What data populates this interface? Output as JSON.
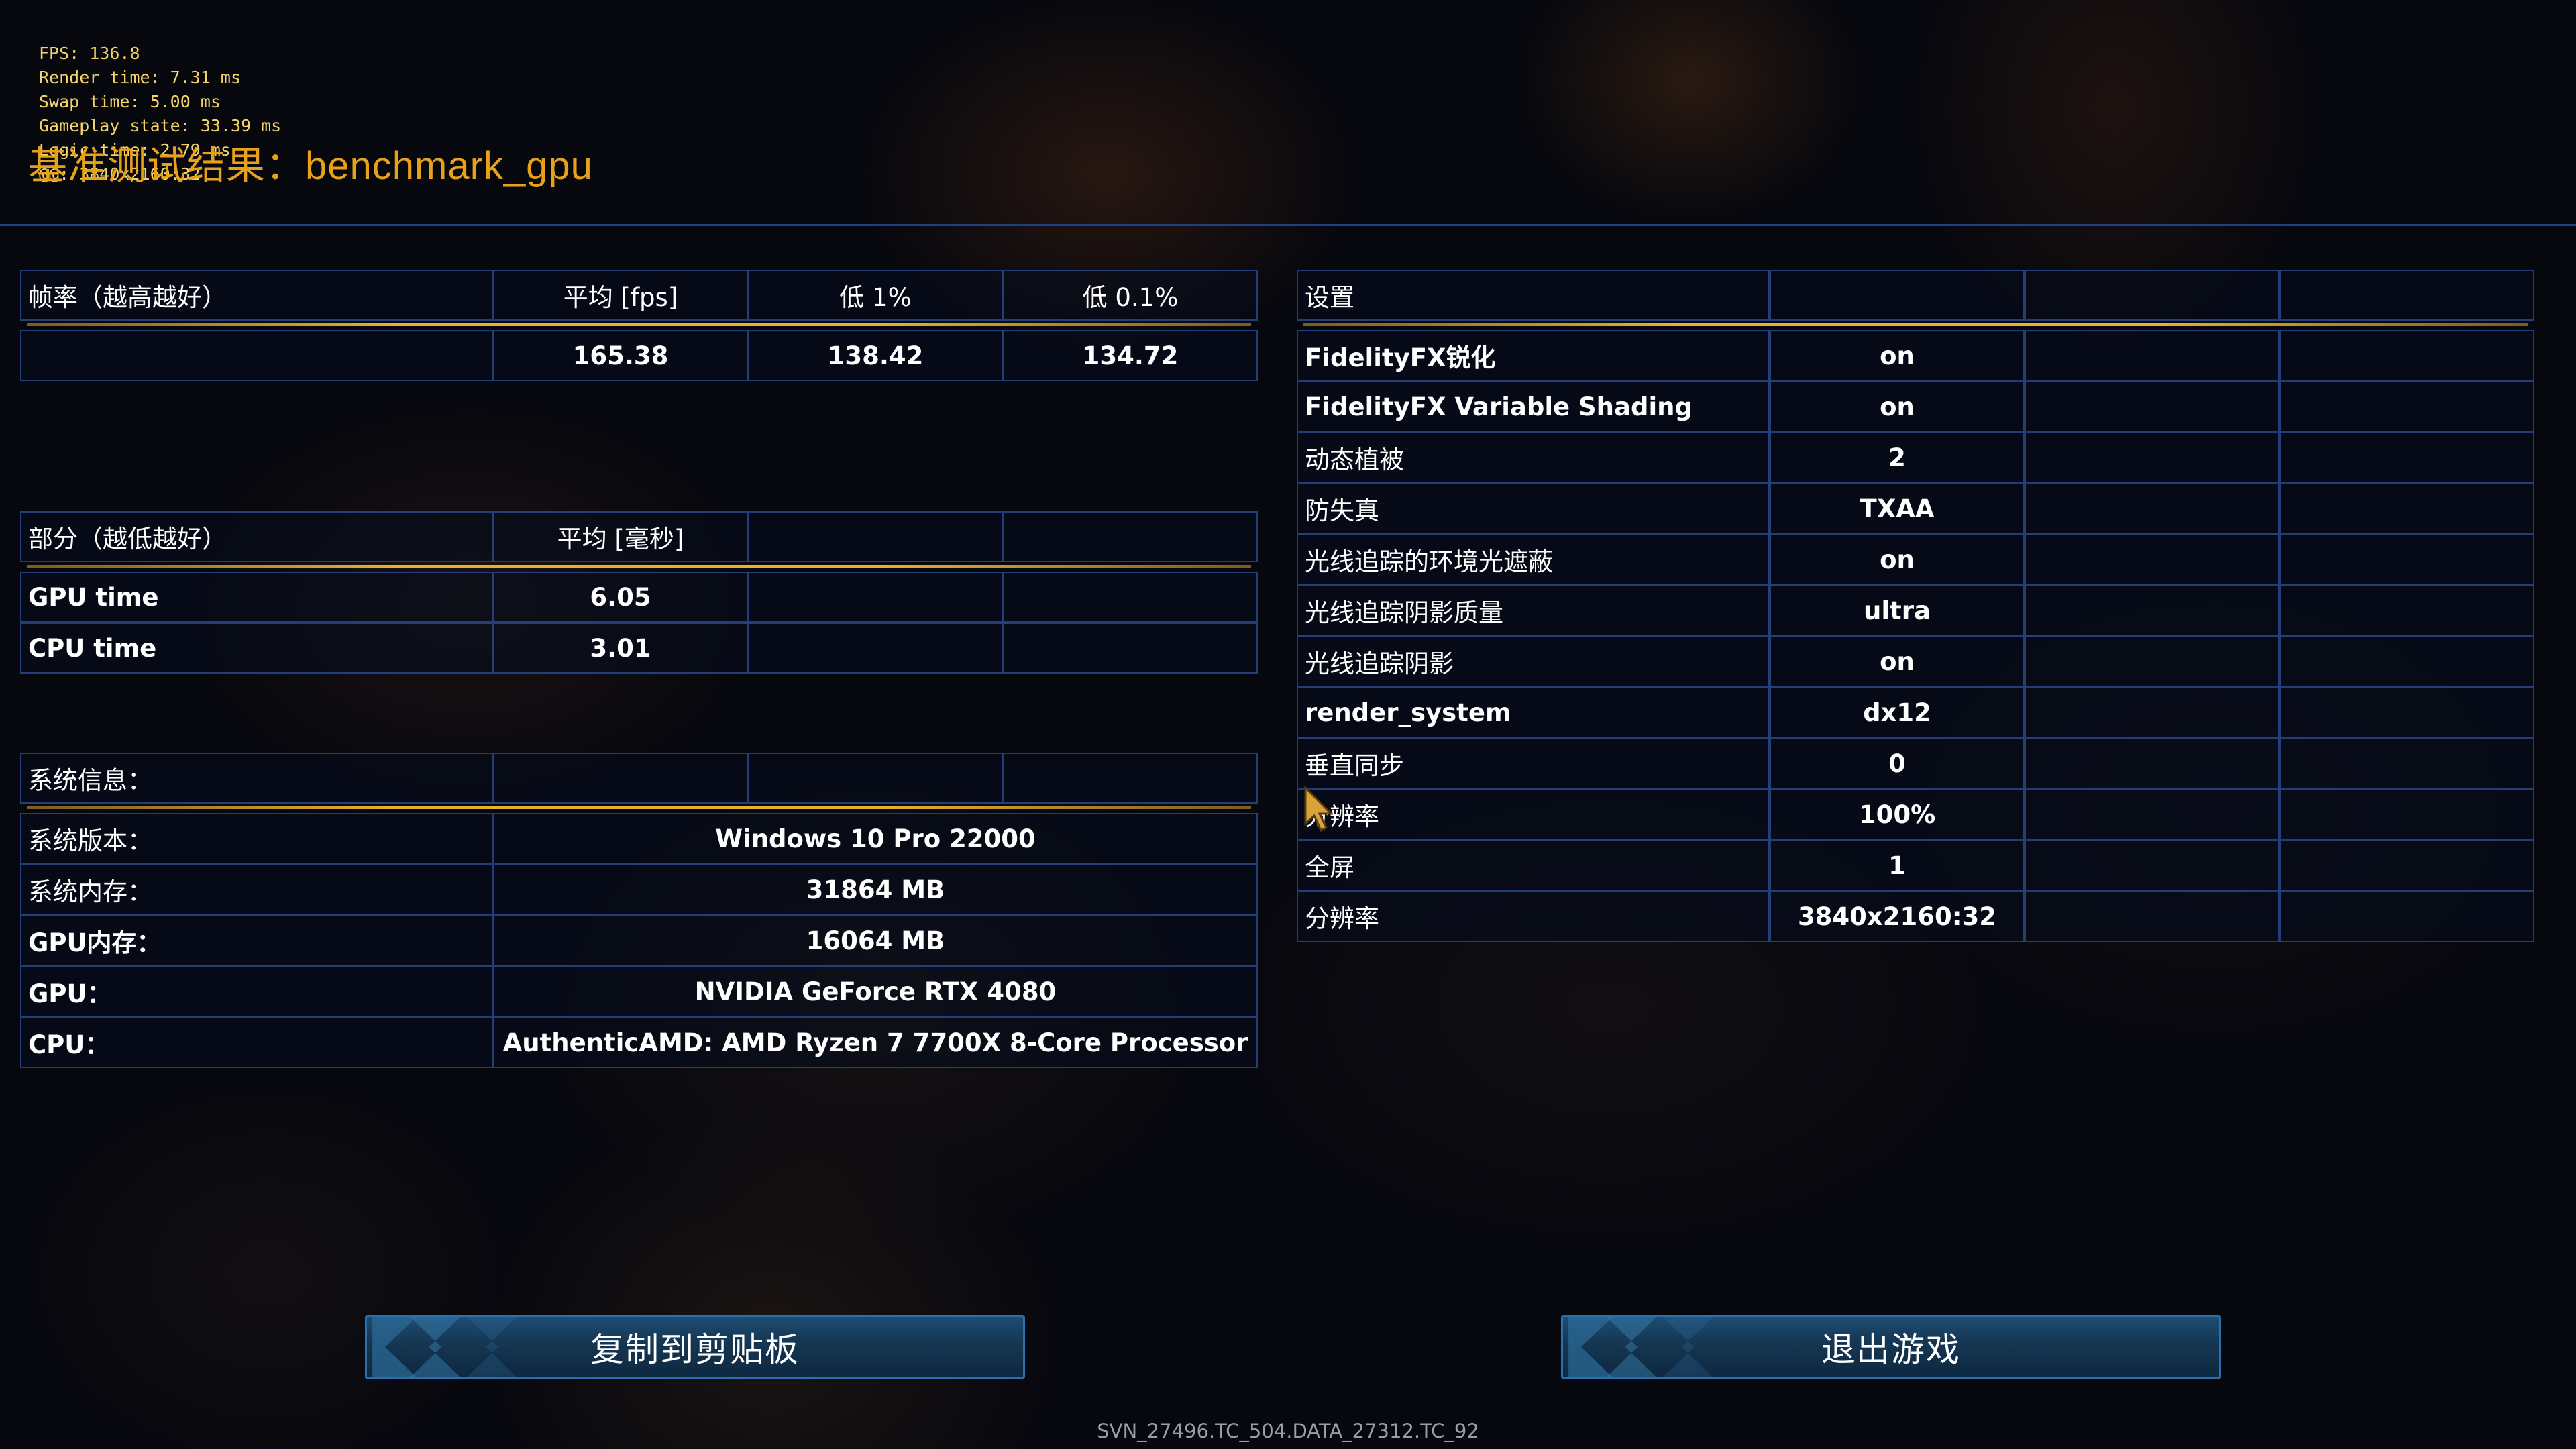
{
  "overlay": {
    "fps": "FPS: 136.8",
    "render_time": "Render time: 7.31 ms",
    "swap_time": "Swap time: 5.00 ms",
    "gameplay_state": "Gameplay state: 33.39 ms",
    "logic_time": "Logic time: 2.79 ms",
    "resolution": "@@: 3840x2160:32"
  },
  "title": "基准测试结果：benchmark_gpu",
  "framerate": {
    "header": [
      "帧率（越高越好）",
      "平均 [fps]",
      "低 1%",
      "低 0.1%"
    ],
    "row": [
      "",
      "165.38",
      "138.42",
      "134.72"
    ]
  },
  "sections": {
    "header": [
      "部分（越低越好）",
      "平均 [毫秒]",
      "",
      ""
    ],
    "rows": [
      {
        "label": "GPU time",
        "avg": "6.05"
      },
      {
        "label": "CPU time",
        "avg": "3.01"
      }
    ]
  },
  "sysinfo": {
    "header": "系统信息：",
    "rows": [
      {
        "label": "系统版本：",
        "value": "Windows 10 Pro 22000"
      },
      {
        "label": "系统内存：",
        "value": "31864 MB"
      },
      {
        "label": "GPU内存：",
        "value": "16064 MB"
      },
      {
        "label": "GPU：",
        "value": "NVIDIA GeForce RTX 4080"
      },
      {
        "label": "CPU：",
        "value": "AuthenticAMD: AMD Ryzen 7 7700X 8-Core Processor"
      }
    ]
  },
  "settings": {
    "header": "设置",
    "rows": [
      {
        "label": "FidelityFX锐化",
        "value": "on"
      },
      {
        "label": "FidelityFX Variable Shading",
        "value": "on"
      },
      {
        "label": "动态植被",
        "value": "2"
      },
      {
        "label": "防失真",
        "value": "TXAA"
      },
      {
        "label": "光线追踪的环境光遮蔽",
        "value": "on"
      },
      {
        "label": "光线追踪阴影质量",
        "value": "ultra"
      },
      {
        "label": "光线追踪阴影",
        "value": "on"
      },
      {
        "label": "render_system",
        "value": "dx12"
      },
      {
        "label": "垂直同步",
        "value": "0"
      },
      {
        "label": "分辨率",
        "value": "100%"
      },
      {
        "label": "全屏",
        "value": "1"
      },
      {
        "label": "分辨率",
        "value": "3840x2160:32"
      }
    ]
  },
  "buttons": {
    "copy": "复制到剪贴板",
    "exit": "退出游戏"
  },
  "footer": "SVN_27496.TC_504.DATA_27312.TC_92",
  "colors": {
    "title": "#e8a21a",
    "overlay_text": "#f3d46a",
    "cell_border": "#243f78",
    "separator": "#e7b12a",
    "button": "#1a4366"
  }
}
